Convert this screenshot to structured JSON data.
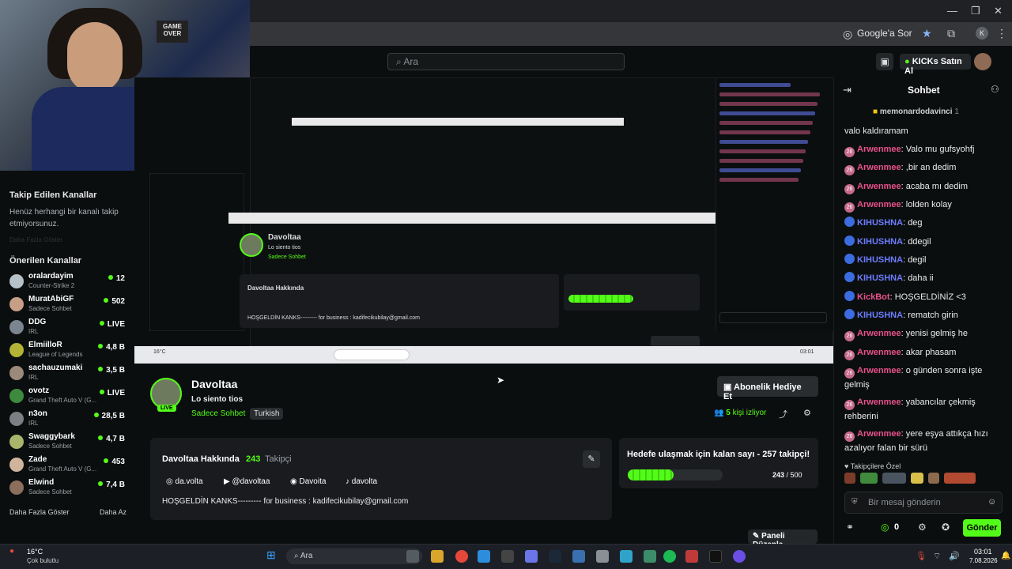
{
  "browser": {
    "google_label": "Google'a Sor",
    "profile": "K"
  },
  "kick": {
    "search_placeholder": "Ara",
    "kicks_label": "KICKs Satın Al"
  },
  "webcam": {
    "sign_text": "GAME OVER"
  },
  "sidebar": {
    "following_title": "Takip Edilen Kanallar",
    "following_empty": "Henüz herhangi bir kanalı takip etmiyorsunuz.",
    "show_more_faded": "Daha Fazla Göster",
    "recommended_title": "Önerilen Kanallar",
    "channels": [
      {
        "name": "oralardayim",
        "sub": "Counter-Strike 2",
        "viewers": "12",
        "color": "#b7c1c8"
      },
      {
        "name": "MuratAbiGF",
        "sub": "Sadece Sohbet",
        "viewers": "502",
        "color": "#c79f86"
      },
      {
        "name": "DDG",
        "sub": "IRL",
        "viewers": "LIVE",
        "color": "#7a8590"
      },
      {
        "name": "ElmiilloR",
        "sub": "League of Legends",
        "viewers": "4,8 B",
        "color": "#b4b335"
      },
      {
        "name": "sachauzumaki",
        "sub": "IRL",
        "viewers": "3,5 B",
        "color": "#9a8a7c"
      },
      {
        "name": "ovotz",
        "sub": "Grand Theft Auto V (G...",
        "viewers": "LIVE",
        "color": "#3d8a3f"
      },
      {
        "name": "n3on",
        "sub": "IRL",
        "viewers": "28,5 B",
        "color": "#7c7f83"
      },
      {
        "name": "Swaggybark",
        "sub": "Sadece Sohbet",
        "viewers": "4,7 B",
        "color": "#a9b56b"
      },
      {
        "name": "Zade",
        "sub": "Grand Theft Auto V (G...",
        "viewers": "453",
        "color": "#d0b49b"
      },
      {
        "name": "Elwind",
        "sub": "Sadece Sohbet",
        "viewers": "7,4 B",
        "color": "#8c6e5c"
      }
    ],
    "show_more": "Daha Fazla Göster",
    "show_less": "Daha Az"
  },
  "stream": {
    "name": "Davoltaa",
    "title": "Lo siento tios",
    "category": "Sadece Sohbet",
    "tag": "Turkish",
    "live": "LIVE",
    "gift_label": "Abonelik Hediye Et",
    "viewers": "5",
    "viewers_label": "kişi izliyor",
    "about_title": "Davoltaa Hakkında",
    "followers": "243",
    "followers_label": "Takipçi",
    "socials": [
      "da.volta",
      "@davoltaa",
      "Davoita",
      "davolta"
    ],
    "bio": "HOŞGELDİN KANKS--------- for business : kadifecikubilay@gmail.com",
    "goal_title": "Hedefe ulaşmak için kalan sayı - 257 takipçi!",
    "goal_current": "243",
    "goal_total": "500",
    "goal_progress": 0.486,
    "edit_panel": "Paneli Düzenle"
  },
  "chat": {
    "title": "Sohbet",
    "pinned_user": "memonardodavinci",
    "pinned_count": "1",
    "pinned_text": "valo kaldıramam",
    "messages": [
      {
        "user": "Arwenmee",
        "color": "#e8528b",
        "text": "Valo mu gufsyohfj",
        "badge": "26"
      },
      {
        "user": "Arwenmee",
        "color": "#e8528b",
        "text": ",bir an dedim",
        "badge": "26"
      },
      {
        "user": "Arwenmee",
        "color": "#e8528b",
        "text": "acaba mı dedim",
        "badge": "26"
      },
      {
        "user": "Arwenmee",
        "color": "#e8528b",
        "text": "lolden kolay",
        "badge": "26"
      },
      {
        "user": "KIHUSHNA",
        "color": "#6c7dff",
        "text": "deg",
        "badge": ""
      },
      {
        "user": "KIHUSHNA",
        "color": "#6c7dff",
        "text": "ddegil",
        "badge": ""
      },
      {
        "user": "KIHUSHNA",
        "color": "#6c7dff",
        "text": "degil",
        "badge": ""
      },
      {
        "user": "KIHUSHNA",
        "color": "#6c7dff",
        "text": "daha ii",
        "badge": ""
      },
      {
        "user": "KickBot",
        "color": "#e8528b",
        "text": "HOŞGELDİNİZ <3",
        "badge": ""
      },
      {
        "user": "KIHUSHNA",
        "color": "#6c7dff",
        "text": "rematch girin",
        "badge": ""
      },
      {
        "user": "Arwenmee",
        "color": "#e8528b",
        "text": "yenisi gelmiş he",
        "badge": "26"
      },
      {
        "user": "Arwenmee",
        "color": "#e8528b",
        "text": "akar phasam",
        "badge": "26"
      },
      {
        "user": "Arwenmee",
        "color": "#e8528b",
        "text": "o günden sonra işte gelmiş",
        "badge": "26"
      },
      {
        "user": "Arwenmee",
        "color": "#e8528b",
        "text": "yabancılar çekmiş rehberini",
        "badge": "26"
      },
      {
        "user": "Arwenmee",
        "color": "#e8528b",
        "text": "yere eşya attıkça hızı azalıyor falan bir sürü",
        "badge": "26"
      }
    ],
    "emote_label": "Takipçilere Özel",
    "input_placeholder": "Bir mesaj gönderin",
    "points": "0",
    "send": "Gönder"
  },
  "taskbar": {
    "temp": "16°C",
    "weather": "Çok bulutlu",
    "search": "Ara",
    "time": "03:01",
    "date": "7.08.2026"
  }
}
